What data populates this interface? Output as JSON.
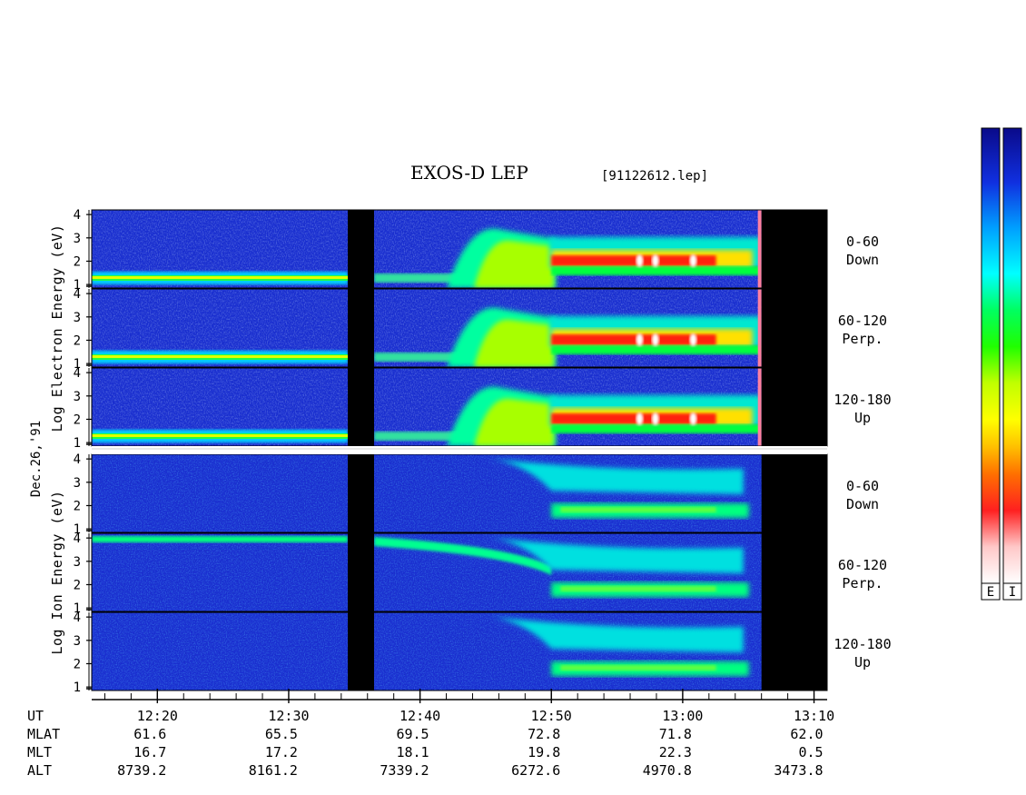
{
  "title": "EXOS-D LEP",
  "file_ref": "[91122612.lep]",
  "date_label": "Dec.26,'91",
  "colors": {
    "background_blue": "#1a2fd0",
    "datagap": "#000000",
    "scale": [
      "#0a0a8a",
      "#1030e0",
      "#00a0ff",
      "#00ffff",
      "#00ff60",
      "#20ff00",
      "#c0ff00",
      "#ffff00",
      "#ffc000",
      "#ff7000",
      "#ff2020",
      "#ffc8c8"
    ]
  },
  "chart_data": {
    "type": "heatmap",
    "description": "energy-time spectrogram",
    "x_ticks": [
      "12:20",
      "12:30",
      "12:40",
      "12:50",
      "13:00",
      "13:10"
    ],
    "x_range_ut": [
      "12:15",
      "13:11"
    ],
    "data_gap_ut": [
      "12:34:30",
      "12:36:30"
    ],
    "data_end_ut": "13:06",
    "y_ticks": [
      "1",
      "2",
      "3",
      "4"
    ],
    "groups": [
      {
        "species": "Electron",
        "ylabel_words": [
          "Log",
          "Electron",
          "Energy",
          "(eV)"
        ],
        "ylabel_text": "Log Electron Energy (eV)",
        "panels": [
          {
            "pitch": "0-60",
            "dir": "Down"
          },
          {
            "pitch": "60-120",
            "dir": "Perp."
          },
          {
            "pitch": "120-180",
            "dir": "Up"
          }
        ]
      },
      {
        "species": "Ion",
        "ylabel_words": [
          "Log",
          "Ion",
          "Energy",
          "(eV)"
        ],
        "ylabel_text": "Log Ion Energy (eV)",
        "panels": [
          {
            "pitch": "0-60",
            "dir": "Down"
          },
          {
            "pitch": "60-120",
            "dir": "Perp."
          },
          {
            "pitch": "120-180",
            "dir": "Up"
          }
        ]
      }
    ],
    "ephemeris": {
      "labels": [
        "UT",
        "MLAT",
        "MLT",
        "ALT"
      ],
      "rows": [
        [
          "61.6",
          "65.5",
          "69.5",
          "72.8",
          "71.8",
          "62.0"
        ],
        [
          "16.7",
          "17.2",
          "18.1",
          "19.8",
          "22.3",
          "0.5"
        ],
        [
          "8739.2",
          "8161.2",
          "7339.2",
          "6272.6",
          "4970.8",
          "3473.8"
        ]
      ]
    },
    "colorbar_labels": [
      "E",
      "I"
    ]
  }
}
